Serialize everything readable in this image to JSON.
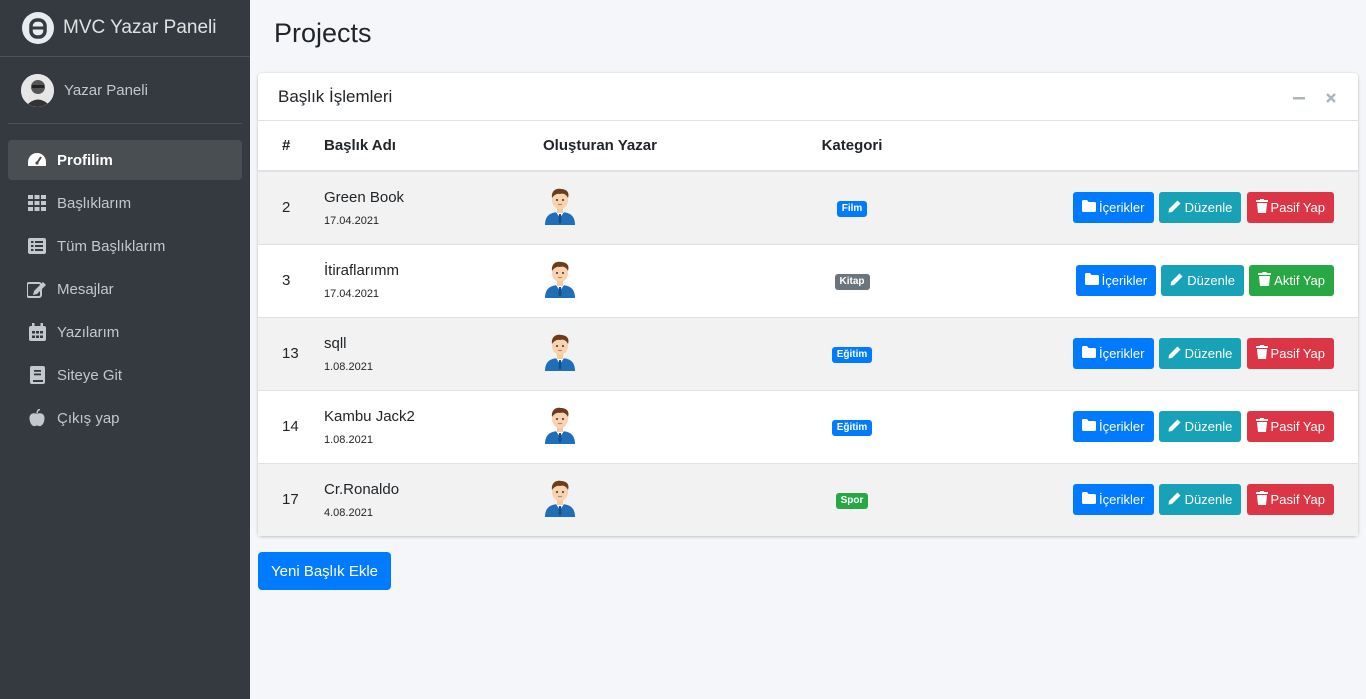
{
  "brand": {
    "title": "MVC Yazar Paneli"
  },
  "user": {
    "name": "Yazar Paneli"
  },
  "nav": [
    {
      "label": "Profilim",
      "icon": "dashboard-icon",
      "active": true
    },
    {
      "label": "Başlıklarım",
      "icon": "grid-icon",
      "active": false
    },
    {
      "label": "Tüm Başlıklarım",
      "icon": "list-icon",
      "active": false
    },
    {
      "label": "Mesajlar",
      "icon": "edit-icon",
      "active": false
    },
    {
      "label": "Yazılarım",
      "icon": "calendar-icon",
      "active": false
    },
    {
      "label": "Siteye Git",
      "icon": "book-icon",
      "active": false
    },
    {
      "label": "Çıkış yap",
      "icon": "apple-icon",
      "active": false
    }
  ],
  "page": {
    "title": "Projects"
  },
  "card": {
    "title": "Başlık İşlemleri"
  },
  "table": {
    "headers": [
      "#",
      "Başlık Adı",
      "Oluşturan Yazar",
      "Kategori",
      ""
    ],
    "rows": [
      {
        "id": "2",
        "title": "Green Book",
        "date": "17.04.2021",
        "category": "Film",
        "category_color": "#007bff",
        "status_label": "Pasif Yap",
        "status_type": "danger"
      },
      {
        "id": "3",
        "title": "İtiraflarımm",
        "date": "17.04.2021",
        "category": "Kitap",
        "category_color": "#6c757d",
        "status_label": "Aktif Yap",
        "status_type": "success"
      },
      {
        "id": "13",
        "title": "sqll",
        "date": "1.08.2021",
        "category": "Eğitim",
        "category_color": "#007bff",
        "status_label": "Pasif Yap",
        "status_type": "danger"
      },
      {
        "id": "14",
        "title": "Kambu Jack2",
        "date": "1.08.2021",
        "category": "Eğitim",
        "category_color": "#007bff",
        "status_label": "Pasif Yap",
        "status_type": "danger"
      },
      {
        "id": "17",
        "title": "Cr.Ronaldo",
        "date": "4.08.2021",
        "category": "Spor",
        "category_color": "#28a745",
        "status_label": "Pasif Yap",
        "status_type": "danger"
      }
    ]
  },
  "buttons": {
    "contents": "İçerikler",
    "edit": "Düzenle"
  },
  "add_button": {
    "label": "Yeni Başlık Ekle"
  },
  "colors": {
    "primary": "#007bff",
    "info": "#17a2b8",
    "danger": "#dc3545",
    "success": "#28a745",
    "sidebar": "#343a40"
  }
}
